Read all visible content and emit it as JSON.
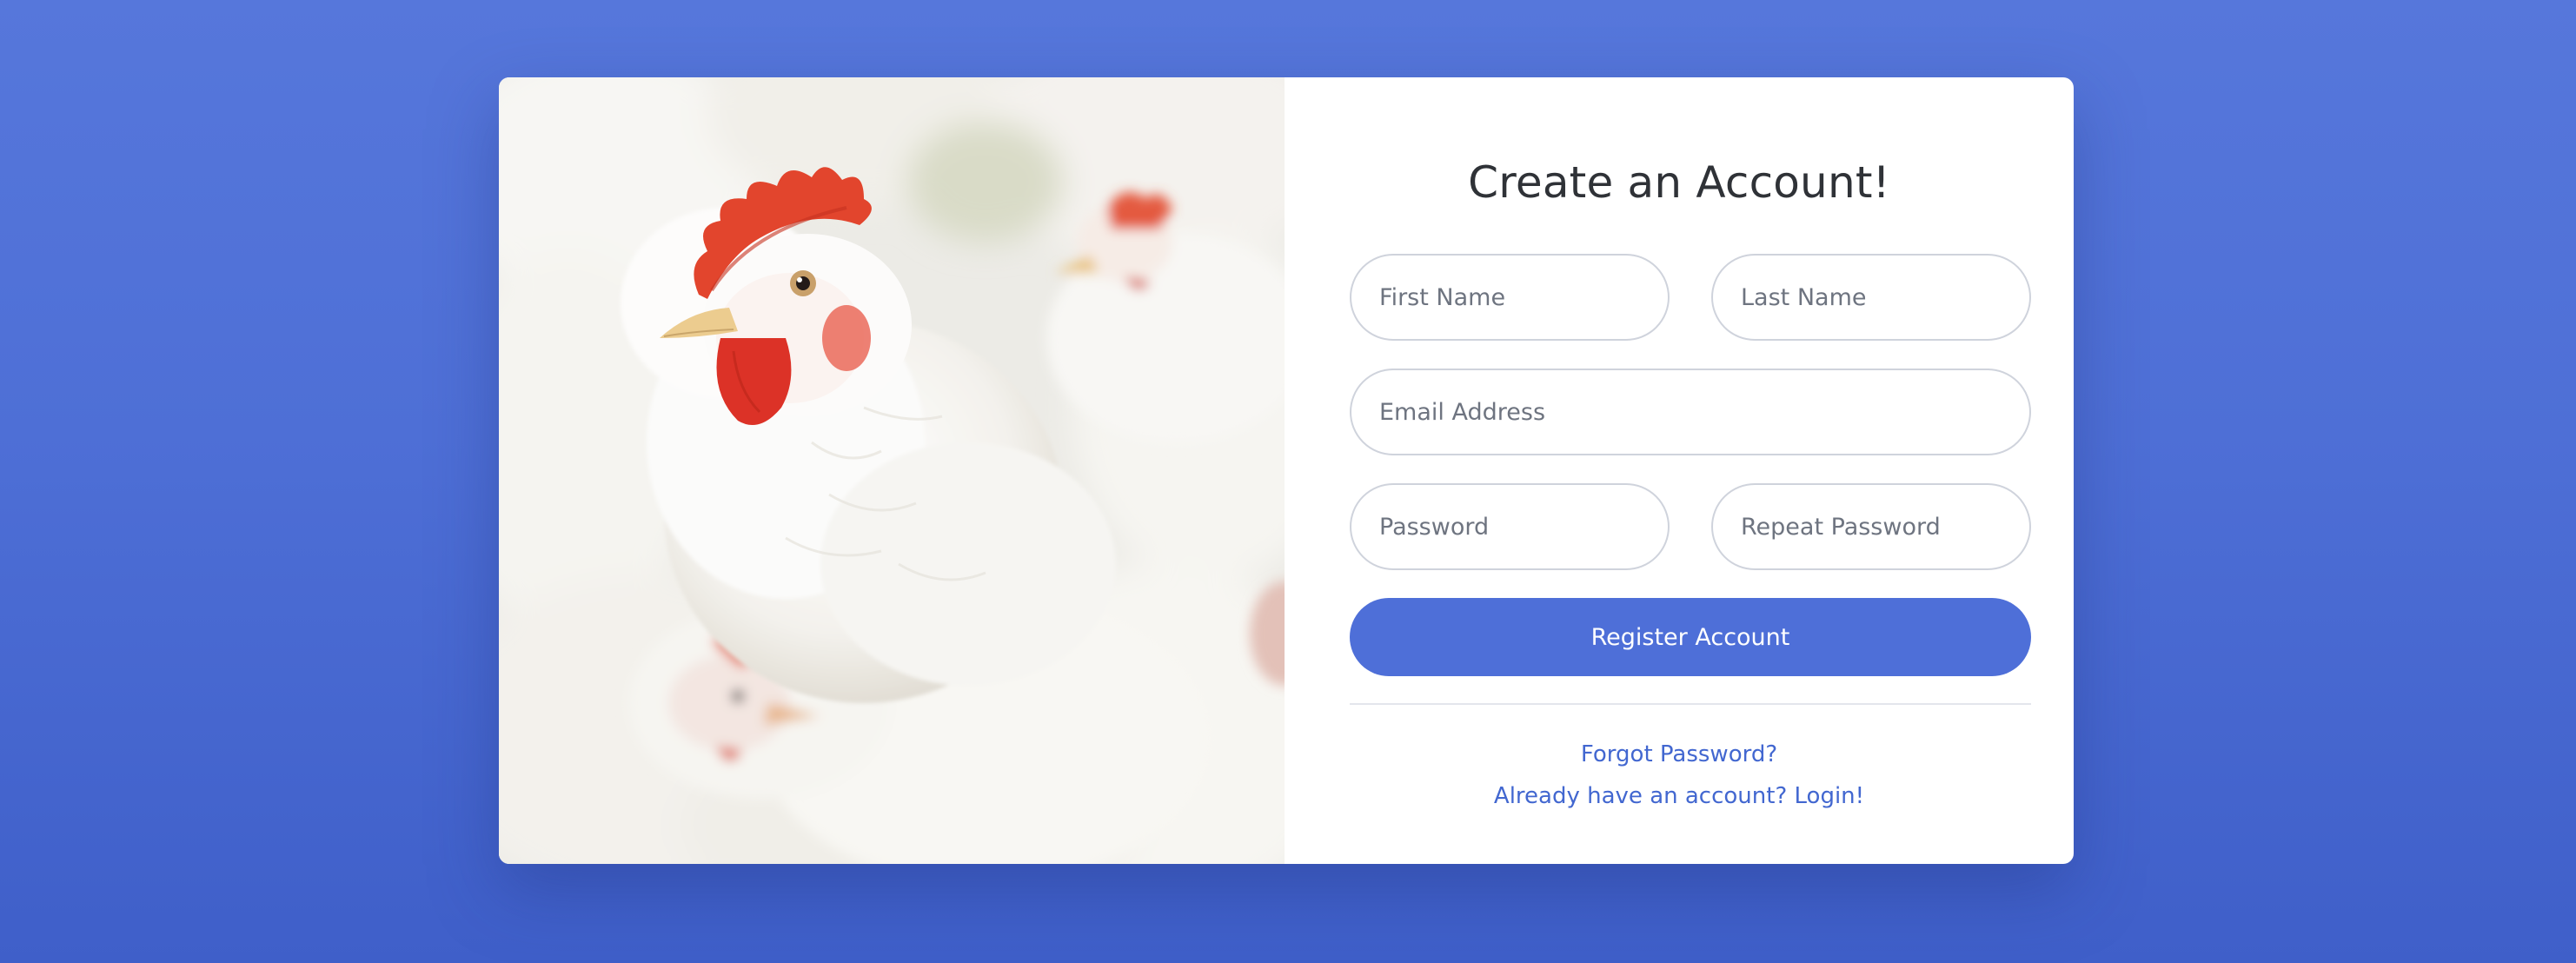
{
  "photo": {
    "subject": "white-chickens"
  },
  "register_form": {
    "title": "Create an Account!",
    "first_name_placeholder": "First Name",
    "last_name_placeholder": "Last Name",
    "email_placeholder": "Email Address",
    "password_placeholder": "Password",
    "repeat_password_placeholder": "Repeat Password",
    "register_label": "Register Account",
    "forgot_password_label": "Forgot Password?",
    "login_label": "Already have an account? Login!"
  },
  "colors": {
    "background": "#4e6fd6",
    "primary_button": "#4e6fd8",
    "link": "#4267d0",
    "title_text": "#2f3237",
    "input_border": "#cfd3dc"
  }
}
